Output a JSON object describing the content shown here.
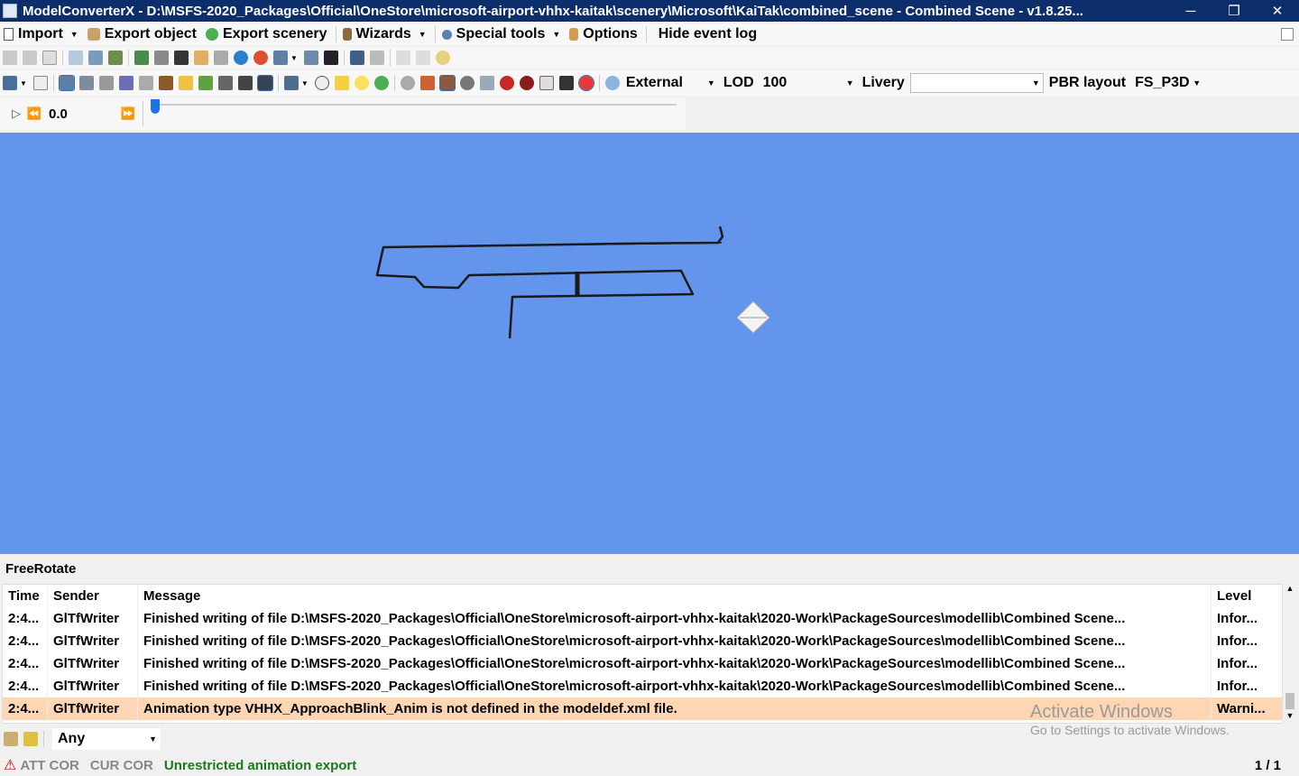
{
  "titlebar": {
    "title": "ModelConverterX - D:\\MSFS-2020_Packages\\Official\\OneStore\\microsoft-airport-vhhx-kaitak\\scenery\\Microsoft\\KaiTak\\combined_scene - Combined Scene - v1.8.25...",
    "minimize": "─",
    "restore": "❐",
    "close": "✕"
  },
  "menubar": {
    "import": "Import",
    "export_object": "Export object",
    "export_scenery": "Export scenery",
    "wizards": "Wizards",
    "special_tools": "Special tools",
    "options": "Options",
    "hide_event_log": "Hide event log"
  },
  "toolbar2": {
    "view_mode": "External",
    "lod_label": "LOD",
    "lod_value": "100",
    "livery_label": "Livery",
    "livery_value": "",
    "pbr_label": "PBR layout",
    "pbr_value": "FS_P3D"
  },
  "timeline": {
    "value": "0.0",
    "slider_position": 0
  },
  "event_log": {
    "mode_label": "FreeRotate",
    "columns": {
      "time": "Time",
      "sender": "Sender",
      "message": "Message",
      "level": "Level"
    },
    "rows": [
      {
        "time": "2:4...",
        "sender": "GlTfWriter",
        "message": "Finished writing of file D:\\MSFS-2020_Packages\\Official\\OneStore\\microsoft-airport-vhhx-kaitak\\2020-Work\\PackageSources\\modellib\\Combined Scene...",
        "level": "Infor..."
      },
      {
        "time": "2:4...",
        "sender": "GlTfWriter",
        "message": "Finished writing of file D:\\MSFS-2020_Packages\\Official\\OneStore\\microsoft-airport-vhhx-kaitak\\2020-Work\\PackageSources\\modellib\\Combined Scene...",
        "level": "Infor..."
      },
      {
        "time": "2:4...",
        "sender": "GlTfWriter",
        "message": "Finished writing of file D:\\MSFS-2020_Packages\\Official\\OneStore\\microsoft-airport-vhhx-kaitak\\2020-Work\\PackageSources\\modellib\\Combined Scene...",
        "level": "Infor..."
      },
      {
        "time": "2:4...",
        "sender": "GlTfWriter",
        "message": "Finished writing of file D:\\MSFS-2020_Packages\\Official\\OneStore\\microsoft-airport-vhhx-kaitak\\2020-Work\\PackageSources\\modellib\\Combined Scene...",
        "level": "Infor..."
      },
      {
        "time": "2:4...",
        "sender": "GlTfWriter",
        "message": "Animation type VHHX_ApproachBlink_Anim is not defined in the modeldef.xml file.",
        "level": "Warni..."
      }
    ],
    "filter_value": "Any",
    "watermark_line1": "Activate Windows",
    "watermark_line2": "Go to Settings to activate Windows."
  },
  "statusbar": {
    "att_cor": "ATT COR",
    "cur_cor": "CUR COR",
    "animation_export": "Unrestricted animation export",
    "page": "1 / 1"
  },
  "colors": {
    "viewport_bg": "#6495ed",
    "warning_row": "#fed6b4",
    "titlebar": "#0c2f6b",
    "status_green": "#1a7a1a"
  }
}
